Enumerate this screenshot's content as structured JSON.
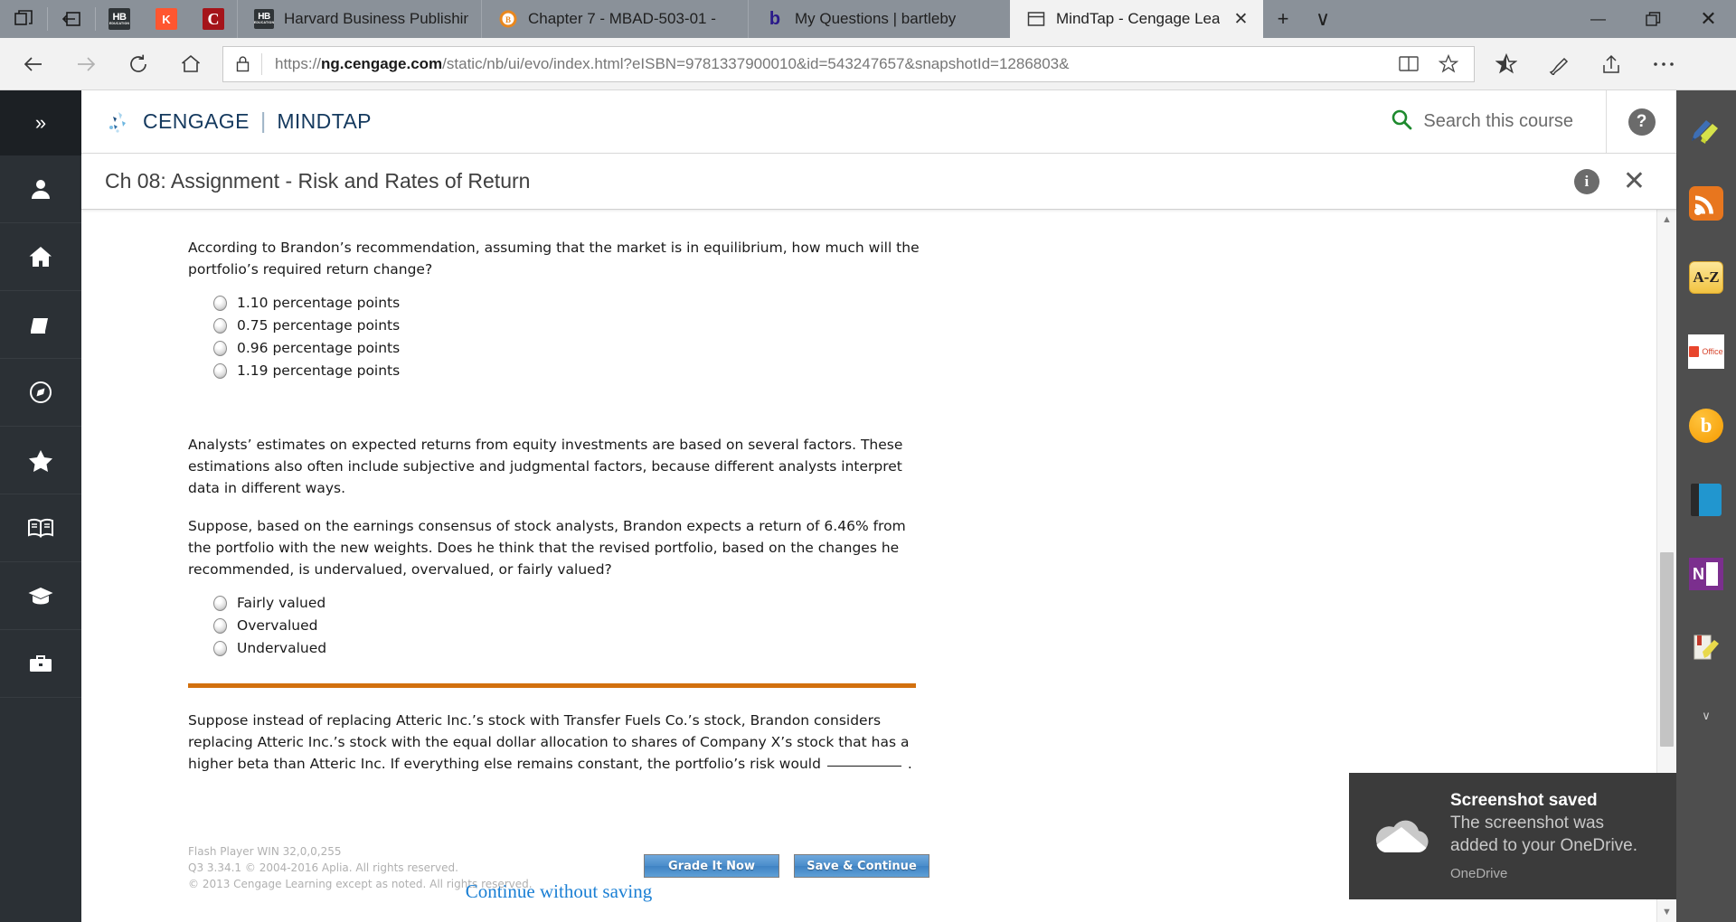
{
  "browser": {
    "tab_controls": [
      {
        "name": "show-tabs-aside",
        "label": "Tabs"
      },
      {
        "name": "set-tabs-aside",
        "label": "Set tabs aside"
      }
    ],
    "favorites_bar": [
      {
        "name": "favicon-hb",
        "label": "HB"
      },
      {
        "name": "favicon-k",
        "label": "K"
      },
      {
        "name": "favicon-c",
        "label": "C"
      }
    ],
    "tabs": [
      {
        "title": "Harvard Business Publishing",
        "icon": "hb-icon",
        "active": false
      },
      {
        "title": "Chapter 7 - MBAD-503-01 -",
        "icon": "blackboard-icon",
        "active": false
      },
      {
        "title": "My Questions | bartleby",
        "icon": "bartleby-icon",
        "active": false
      },
      {
        "title": "MindTap - Cengage Lea",
        "icon": "window-icon",
        "active": true
      }
    ],
    "new_tab_label": "+",
    "tab_menu_label": "∨",
    "window_controls": {
      "minimize": "—",
      "restore": "❐",
      "close": "✕"
    },
    "nav": {
      "back": "←",
      "forward": "→",
      "refresh": "↻",
      "home": "⌂"
    },
    "address": {
      "scheme": "https://",
      "host": "ng.cengage.com",
      "path": "/static/nb/ui/evo/index.html?eISBN=9781337900010&id=543247657&snapshotId=1286803&",
      "full": "https://ng.cengage.com/static/nb/ui/evo/index.html?eISBN=9781337900010&id=543247657&snapshotId=1286803&",
      "lock_icon": "lock-icon",
      "reading_view_icon": "reading-view-icon",
      "favorite_icon": "star-icon"
    },
    "toolbar_right": [
      {
        "name": "favorites-hub-icon",
        "label": "Favorites"
      },
      {
        "name": "web-notes-icon",
        "label": "Make a Web Note"
      },
      {
        "name": "share-icon",
        "label": "Share"
      },
      {
        "name": "more-icon",
        "label": "Settings and more"
      }
    ]
  },
  "left_rail": {
    "expand_label": "»",
    "items": [
      {
        "name": "sidebar-item-profile",
        "icon": "person-icon"
      },
      {
        "name": "sidebar-item-home",
        "icon": "home-icon"
      },
      {
        "name": "sidebar-item-ebook",
        "icon": "book-icon"
      },
      {
        "name": "sidebar-item-explore",
        "icon": "compass-icon"
      },
      {
        "name": "sidebar-item-favorites",
        "icon": "star-icon"
      },
      {
        "name": "sidebar-item-reader",
        "icon": "open-book-icon"
      },
      {
        "name": "sidebar-item-grades",
        "icon": "graduation-cap-icon"
      },
      {
        "name": "sidebar-item-tools",
        "icon": "briefcase-icon"
      }
    ]
  },
  "mindtap": {
    "brand_primary": "CENGAGE",
    "brand_secondary": "MINDTAP",
    "brand_color": "#14395e",
    "search_placeholder": "Search this course",
    "search_icon": "search-icon",
    "help_label": "?",
    "title": "Ch 08: Assignment - Risk and Rates of Return",
    "info_label": "i",
    "close_label": "✕"
  },
  "assignment": {
    "question1": {
      "text": "According to Brandon’s recommendation, assuming that the market is in equilibrium, how much will the portfolio’s required return change?",
      "options": [
        "1.10 percentage points",
        "0.75 percentage points",
        "0.96 percentage points",
        "1.19 percentage points"
      ]
    },
    "paragraph1": "Analysts’ estimates on expected returns from equity investments are based on several factors. These estimations also often include subjective and judgmental factors, because different analysts interpret data in different ways.",
    "question2": {
      "text": "Suppose, based on the earnings consensus of stock analysts, Brandon expects a return of 6.46% from the portfolio with the new weights. Does he think that the revised portfolio, based on the changes he recommended, is undervalued, overvalued, or fairly valued?",
      "options": [
        "Fairly valued",
        "Overvalued",
        "Undervalued"
      ]
    },
    "divider_color": "#d2700e",
    "question3": {
      "text_before": "Suppose instead of replacing Atteric Inc.’s stock with Transfer Fuels Co.’s stock, Brandon considers replacing Atteric Inc.’s stock with the equal dollar allocation to shares of Company X’s stock that has a higher beta than Atteric Inc. If everything else remains constant, the portfolio’s risk would",
      "blank_value": "",
      "text_after": "."
    },
    "legal": [
      "Flash Player WIN 32,0,0,255",
      "Q3 3.34.1 © 2004-2016 Aplia. All rights reserved.",
      "© 2013 Cengage Learning except as noted. All rights reserved."
    ],
    "buttons": [
      {
        "name": "grade-it-now-button",
        "label": "Grade It Now"
      },
      {
        "name": "save-and-continue-button",
        "label": "Save & Continue"
      }
    ],
    "continue_link": "Continue without saving"
  },
  "right_rail": {
    "items": [
      {
        "name": "pen-highlighter-icon",
        "label": "Annotate"
      },
      {
        "name": "rss-icon",
        "label": "RSS"
      },
      {
        "name": "a-z-dictionary-icon",
        "label": "A-Z"
      },
      {
        "name": "office-icon",
        "label": "Office"
      },
      {
        "name": "bing-icon",
        "label": "Bing"
      },
      {
        "name": "blue-book-icon",
        "label": "Book"
      },
      {
        "name": "onenote-icon",
        "label": "OneNote"
      },
      {
        "name": "bookmark-highlighter-icon",
        "label": "Highlighter"
      }
    ],
    "scroll_down_label": "∨"
  },
  "toast": {
    "title": "Screenshot saved",
    "message": "The screenshot was added to your OneDrive.",
    "app": "OneDrive",
    "icon": "onedrive-cloud-icon"
  },
  "scrollbar": {
    "up_label": "▲",
    "down_label": "▼"
  }
}
